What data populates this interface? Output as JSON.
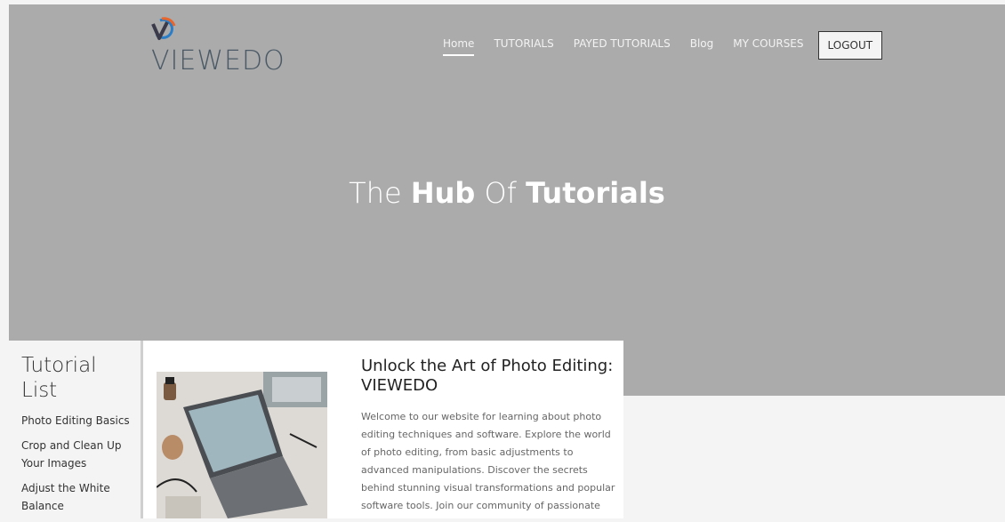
{
  "brand": {
    "name": "VIEWEDO"
  },
  "nav": {
    "items": [
      "Home",
      "TUTORIALS",
      "PAYED TUTORIALS",
      "Blog",
      "MY COURSES"
    ],
    "logout": "LOGOUT"
  },
  "hero": {
    "title_part1": "The ",
    "title_bold1": "Hub",
    "title_part2": " Of ",
    "title_bold2": "Tutorials"
  },
  "sidebar": {
    "heading": "Tutorial List",
    "items": [
      "Photo Editing Basics",
      "Crop and Clean Up Your Images",
      "Adjust the White Balance"
    ]
  },
  "card": {
    "title": "Unlock the Art of Photo Editing: VIEWEDO",
    "text": "Welcome to our website for learning about photo editing techniques and software. Explore the world of photo editing, from basic adjustments to advanced manipulations. Discover the secrets behind stunning visual transformations and popular software tools. Join our community of passionate"
  },
  "colors": {
    "hero_bg": "#ababab",
    "logo_blue": "#2a7ec7",
    "logo_orange": "#e8652c"
  }
}
